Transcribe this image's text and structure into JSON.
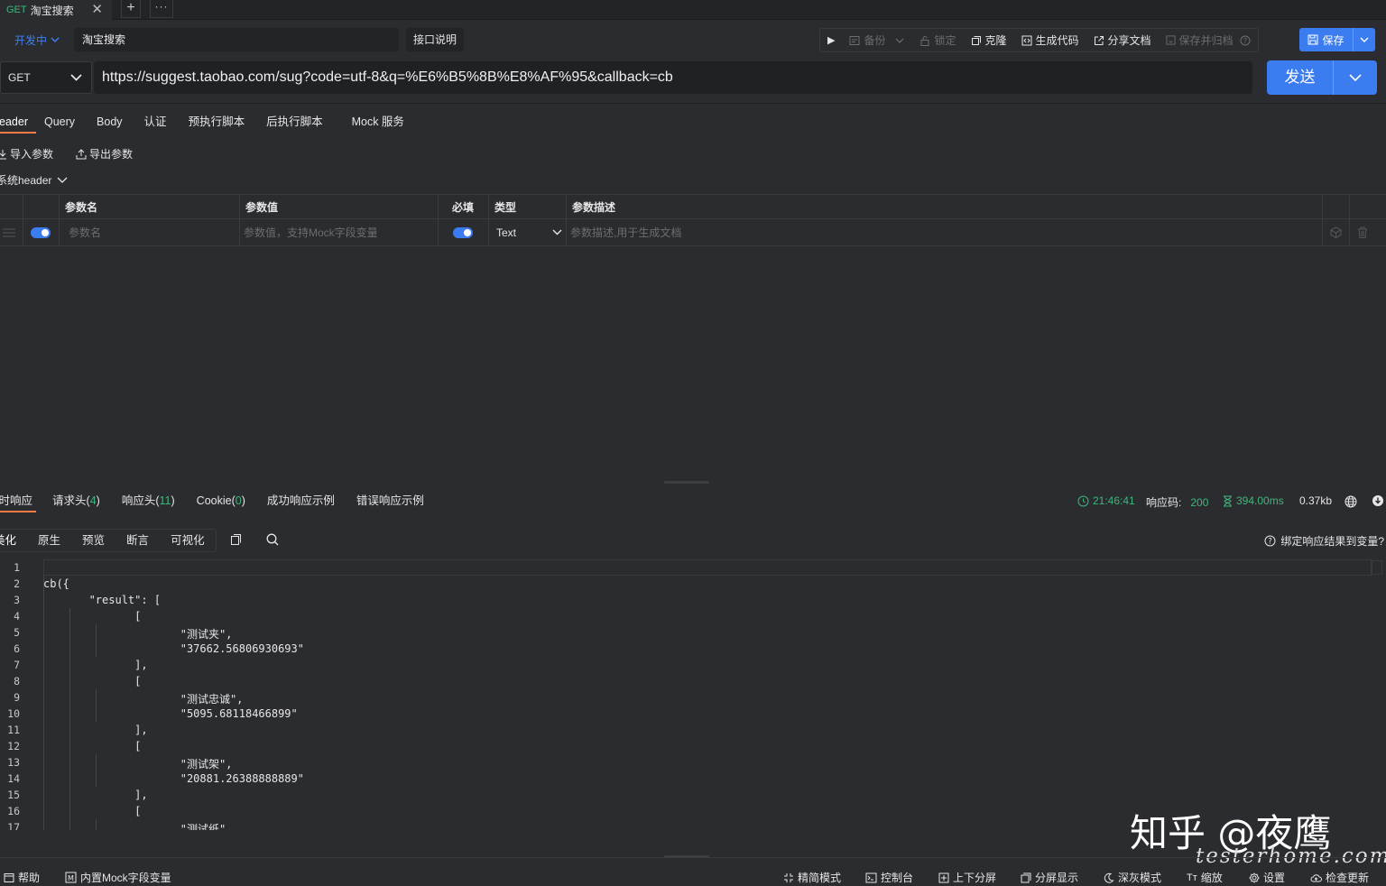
{
  "tab": {
    "method": "GET",
    "title": "淘宝搜索",
    "close": "✕",
    "add": "+",
    "more": "···"
  },
  "request": {
    "status": "开发中",
    "name": "淘宝搜索",
    "doc_button": "接口说明",
    "method": "GET",
    "url": "https://suggest.taobao.com/sug?code=utf-8&q=%E6%B5%8B%E8%AF%95&callback=cb",
    "send": "发送"
  },
  "toolbar": {
    "run": "▶",
    "backup": "备份",
    "lock": "锁定",
    "clone": "克隆",
    "gen_code": "生成代码",
    "share_doc": "分享文档",
    "save_archive": "保存并归档",
    "save": "保存"
  },
  "req_tabs": [
    "Header",
    "Query",
    "Body",
    "认证",
    "预执行脚本",
    "后执行脚本",
    "Mock 服务"
  ],
  "params": {
    "import": "导入参数",
    "export": "导出参数",
    "sys_header": "系统header"
  },
  "table": {
    "headers": [
      "参数名",
      "参数值",
      "必填",
      "类型",
      "参数描述"
    ],
    "row": {
      "name_ph": "参数名",
      "value_ph": "参数值，支持Mock字段变量",
      "type": "Text",
      "desc_ph": "参数描述,用于生成文档"
    }
  },
  "resp_tabs": [
    {
      "label": "实时响应",
      "count": ""
    },
    {
      "label": "请求头",
      "count": "4"
    },
    {
      "label": "响应头",
      "count": "11"
    },
    {
      "label": "Cookie",
      "count": "0"
    },
    {
      "label": "成功响应示例",
      "count": ""
    },
    {
      "label": "错误响应示例",
      "count": ""
    }
  ],
  "resp_meta": {
    "time": "21:46:41",
    "code_label": "响应码:",
    "code": "200",
    "duration": "394.00ms",
    "size": "0.37kb"
  },
  "view_modes": [
    "美化",
    "原生",
    "预览",
    "断言",
    "可视化"
  ],
  "bind_var": "绑定响应结果到变量?",
  "code_lines": [
    "",
    "cb({",
    "    \"result\": [",
    "        [",
    "            \"测试夹\",",
    "            \"37662.56806930693\"",
    "        ],",
    "        [",
    "            \"测试忠诚\",",
    "            \"5095.68118466899\"",
    "        ],",
    "        [",
    "            \"测试架\",",
    "            \"20881.26388888889\"",
    "        ],",
    "        [",
    "            \"测试纸\","
  ],
  "bottom": {
    "help": "帮助",
    "mock_vars": "内置Mock字段变量",
    "simple": "精简模式",
    "console": "控制台",
    "split": "上下分屏",
    "split_show": "分屏显示",
    "dark": "深灰模式",
    "zoom": "缩放",
    "settings": "设置",
    "update": "检查更新"
  },
  "watermark": {
    "zhihu": "知乎 @夜鹰",
    "site": "testerhome.com"
  },
  "colors": {
    "accent": "#3b7cf0",
    "green": "#3eb87a",
    "tab_underline": "#ff7a45",
    "bg": "#2b2c2f"
  }
}
